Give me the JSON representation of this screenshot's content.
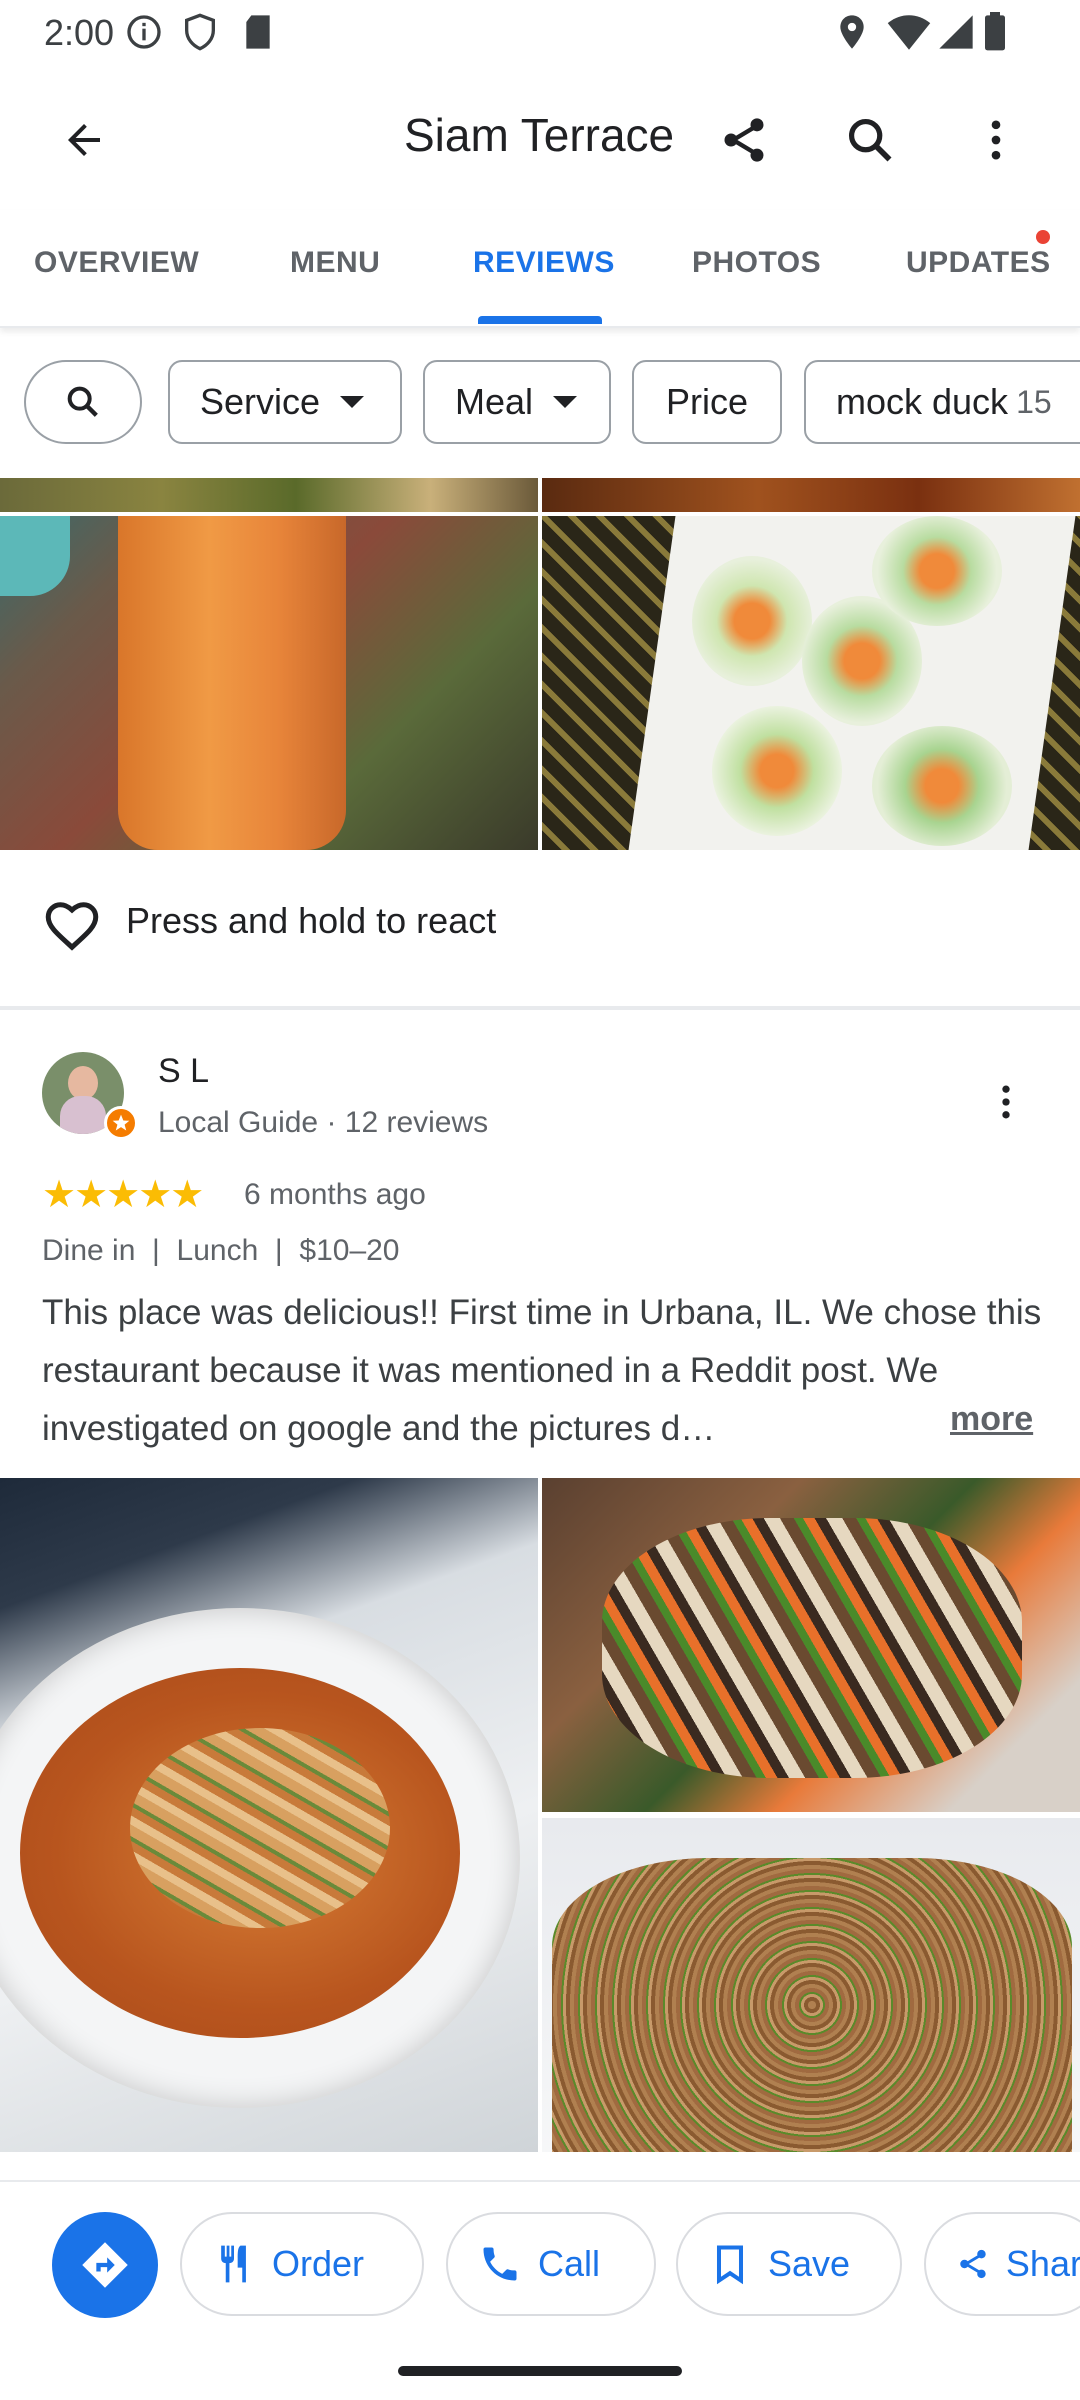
{
  "status_bar": {
    "time": "2:00"
  },
  "app_bar": {
    "title": "Siam Terrace"
  },
  "tabs": [
    {
      "label": "OVERVIEW"
    },
    {
      "label": "MENU"
    },
    {
      "label": "REVIEWS"
    },
    {
      "label": "PHOTOS"
    },
    {
      "label": "UPDATES"
    }
  ],
  "active_tab": "REVIEWS",
  "filters": {
    "service": "Service",
    "meal": "Meal",
    "price": "Price",
    "topic": "mock duck",
    "topic_count": "15"
  },
  "react": {
    "label": "Press and hold to react"
  },
  "review": {
    "author": "S L",
    "subtitle": "Local Guide · 12 reviews",
    "rating": 5,
    "stars": "★★★★★",
    "time_ago": "6 months ago",
    "meta": "Dine in  |  Lunch  |  $10–20",
    "text": "This place was delicious!! First time in Urbana, IL. We chose this restaurant because it was mentioned in a Reddit post. We investigated on google and the pictures d…",
    "more": "more"
  },
  "actions": {
    "order": "Order",
    "call": "Call",
    "save": "Save",
    "share": "Share"
  },
  "colors": {
    "accent": "#1a73e8",
    "star": "#fbbc04",
    "notification_dot": "#ea4335",
    "local_guide_badge": "#f57c00"
  }
}
